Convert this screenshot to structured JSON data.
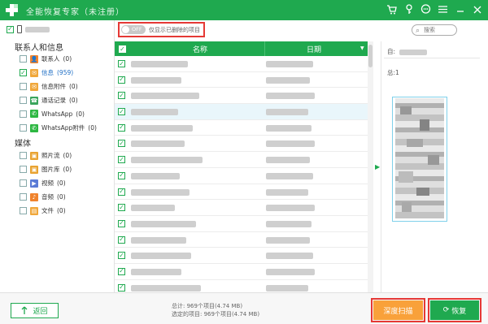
{
  "window": {
    "title": "全能恢复专家（未注册）",
    "controls": [
      "cart-icon",
      "key-icon",
      "chat-icon",
      "menu-icon",
      "minimize-icon",
      "close-icon"
    ]
  },
  "sidebar": {
    "device_checked": true,
    "sections": [
      {
        "title": "联系人和信息",
        "items": [
          {
            "label": "联系人",
            "count": "(0)",
            "icon": "contacts-icon",
            "color": "#f0832d",
            "checked": false,
            "selected": false
          },
          {
            "label": "信息",
            "count": "(959)",
            "icon": "message-icon",
            "color": "#f0a73a",
            "checked": true,
            "selected": true
          },
          {
            "label": "信息附件",
            "count": "(0)",
            "icon": "attachment-icon",
            "color": "#f0a73a",
            "checked": false,
            "selected": false
          },
          {
            "label": "通话记录",
            "count": "(0)",
            "icon": "call-log-icon",
            "color": "#3aa55c",
            "checked": false,
            "selected": false
          },
          {
            "label": "WhatsApp",
            "count": "(0)",
            "icon": "whatsapp-icon",
            "color": "#2db742",
            "checked": false,
            "selected": false
          },
          {
            "label": "WhatsApp附件",
            "count": "(0)",
            "icon": "whatsapp-attachment-icon",
            "color": "#2db742",
            "checked": false,
            "selected": false
          }
        ]
      },
      {
        "title": "媒体",
        "items": [
          {
            "label": "照片流",
            "count": "(0)",
            "icon": "photo-stream-icon",
            "color": "#e9a331",
            "checked": false,
            "selected": false
          },
          {
            "label": "图片库",
            "count": "(0)",
            "icon": "photo-library-icon",
            "color": "#e9a331",
            "checked": false,
            "selected": false
          },
          {
            "label": "视频",
            "count": "(0)",
            "icon": "video-icon",
            "color": "#5a7bd6",
            "checked": false,
            "selected": false
          },
          {
            "label": "音频",
            "count": "(0)",
            "icon": "audio-icon",
            "color": "#f0832d",
            "checked": false,
            "selected": false
          },
          {
            "label": "文件",
            "count": "(0)",
            "icon": "file-icon",
            "color": "#f0a73a",
            "checked": false,
            "selected": false
          }
        ]
      }
    ]
  },
  "toolbar": {
    "toggle_state": "OFF",
    "toggle_label": "仅显示已删除的项目",
    "search_placeholder": "搜索"
  },
  "table": {
    "columns": [
      "名称",
      "日期"
    ],
    "header_checked": true,
    "highlighted_row": 3,
    "row_count": 15
  },
  "preview": {
    "from_label": "自:",
    "total_label": "总:1"
  },
  "footer": {
    "back_label": "返回",
    "total_line": "总计: 969个项目(4.74 MB)",
    "selected_line": "选定的项目: 969个项目(4.74 MB)",
    "deep_scan_label": "深度扫描",
    "recover_label": "恢复"
  },
  "colors": {
    "brand_green": "#1fa94f",
    "highlight_red": "#e53935",
    "deep_scan_orange": "#f9a13a",
    "row_highlight": "#e9f6fb"
  }
}
